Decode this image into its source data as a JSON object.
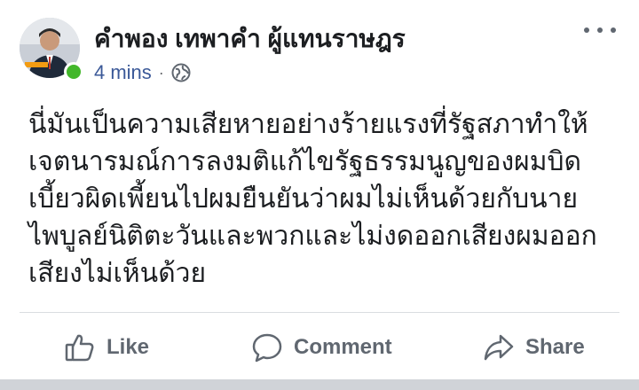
{
  "post": {
    "author": {
      "name": "คำพอง เทพาคำ ผู้แทนราษฎร",
      "status": "online"
    },
    "time": "4 mins",
    "separator": "·",
    "privacy_icon": "globe-icon",
    "more_icon": "more-options-icon",
    "text_lines": [
      "นี่มันเป็นความเสียหายอย่างร้ายแรงที่รัฐสภาทำให้",
      "เจตนารมณ์การลงมติแก้ไขรัฐธรรมนูญของผมบิด",
      "เบี้ยวผิดเพี้ยนไปผมยืนยันว่าผมไม่เห็นด้วยกับนาย",
      "ไพบูลย์นิติตะวันและพวกและไม่งดออกเสียงผมออก",
      "เสียงไม่เห็นด้วย"
    ]
  },
  "actions": [
    {
      "label": "Like",
      "icon": "thumbs-up-icon"
    },
    {
      "label": "Comment",
      "icon": "comment-bubble-icon"
    },
    {
      "label": "Share",
      "icon": "share-arrow-icon"
    }
  ],
  "colors": {
    "name": "#1c1e21",
    "time": "#3b5998",
    "action": "#606770",
    "online": "#42b72a",
    "divider": "#dadde1"
  }
}
